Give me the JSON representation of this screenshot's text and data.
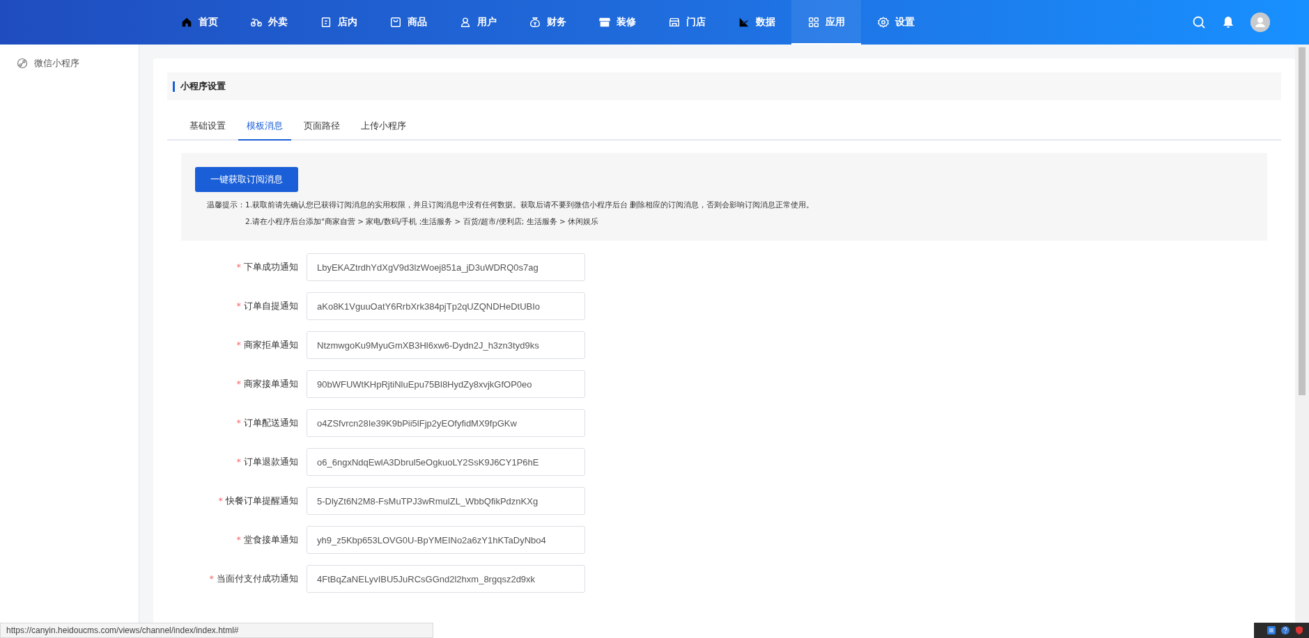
{
  "nav": {
    "items": [
      {
        "label": "首页",
        "selected": false
      },
      {
        "label": "外卖",
        "selected": false
      },
      {
        "label": "店内",
        "selected": false
      },
      {
        "label": "商品",
        "selected": false
      },
      {
        "label": "用户",
        "selected": false
      },
      {
        "label": "财务",
        "selected": false
      },
      {
        "label": "装修",
        "selected": false
      },
      {
        "label": "门店",
        "selected": false
      },
      {
        "label": "数据",
        "selected": false
      },
      {
        "label": "应用",
        "selected": true
      },
      {
        "label": "设置",
        "selected": false
      }
    ]
  },
  "sidebar": {
    "items": [
      {
        "label": "微信小程序",
        "selected": false
      }
    ]
  },
  "panel": {
    "title": "小程序设置",
    "tabs": [
      {
        "label": "基础设置",
        "selected": false
      },
      {
        "label": "模板消息",
        "selected": true
      },
      {
        "label": "页面路径",
        "selected": false
      },
      {
        "label": "上传小程序",
        "selected": false
      }
    ],
    "fetch_button": "一键获取订阅消息",
    "tip_label": "温馨提示：",
    "tips": [
      "1.获取前请先确认您已获得订阅消息的实用权限，并且订阅消息中没有任何数据。获取后请不要到微信小程序后台 删除相应的订阅消息，否则会影响订阅消息正常使用。",
      "2.请在小程序后台添加\"商家自营 > 家电/数码/手机 ;生活服务 > 百货/超市/便利店; 生活服务 > 休闲娱乐"
    ],
    "fields": [
      {
        "required_mark": "*",
        "label": "下单成功通知",
        "value": "LbyEKAZtrdhYdXgV9d3lzWoej851a_jD3uWDRQ0s7ag"
      },
      {
        "required_mark": "*",
        "label": "订单自提通知",
        "value": "aKo8K1VguuOatY6RrbXrk384pjTp2qUZQNDHeDtUBIo"
      },
      {
        "required_mark": "*",
        "label": "商家拒单通知",
        "value": "NtzmwgoKu9MyuGmXB3Hl6xw6-Dydn2J_h3zn3tyd9ks"
      },
      {
        "required_mark": "*",
        "label": "商家接单通知",
        "value": "90bWFUWtKHpRjtiNluEpu75Bl8HydZy8xvjkGfOP0eo"
      },
      {
        "required_mark": "*",
        "label": "订单配送通知",
        "value": "o4ZSfvrcn28Ie39K9bPii5lFjp2yEOfyfidMX9fpGKw"
      },
      {
        "required_mark": "*",
        "label": "订单退款通知",
        "value": "o6_6ngxNdqEwlA3Dbrul5eOgkuoLY2SsK9J6CY1P6hE"
      },
      {
        "required_mark": "*",
        "label": "快餐订单提醒通知",
        "value": "5-DlyZt6N2M8-FsMuTPJ3wRmulZL_WbbQfikPdznKXg"
      },
      {
        "required_mark": "*",
        "label": "堂食接单通知",
        "value": "yh9_z5Kbp653LOVG0U-BpYMEINo2a6zY1hKTaDyNbo4"
      },
      {
        "required_mark": "*",
        "label": "当面付支付成功通知",
        "value": "4FtBqZaNELyvIBU5JuRCsGGnd2l2hxm_8rgqsz2d9xk"
      }
    ]
  },
  "status_bar": {
    "url": "https://canyin.heidoucms.com/views/channel/index/index.html#"
  }
}
